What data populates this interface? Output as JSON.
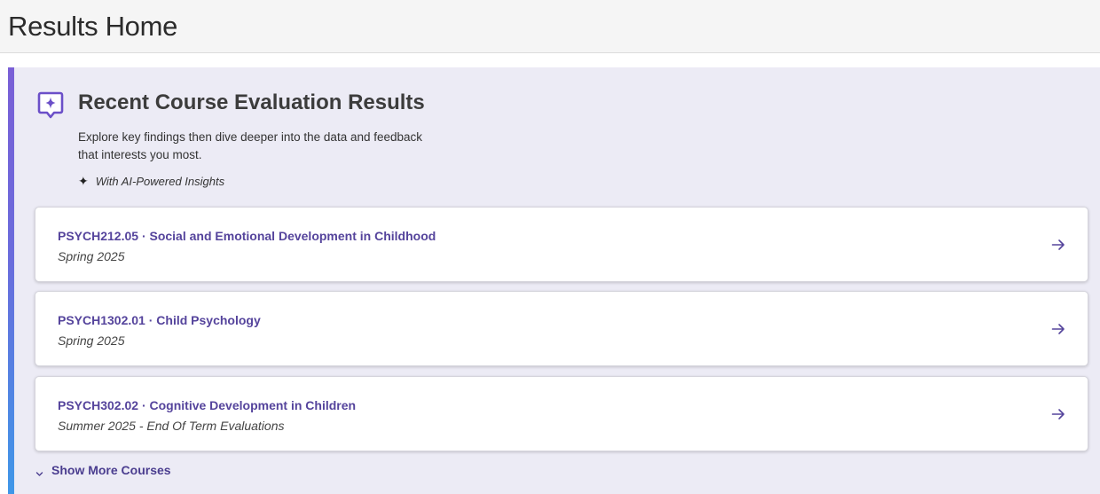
{
  "page": {
    "title": "Results Home"
  },
  "panel": {
    "heading": "Recent Course Evaluation Results",
    "description": "Explore key findings then dive deeper into the data and feedback that interests you most.",
    "ai_badge": "With AI-Powered Insights",
    "icon": "sparkle-chat-icon",
    "accent_colors": [
      "#7a5fd6",
      "#3f97e8"
    ]
  },
  "courses": [
    {
      "title": "PSYCH212.05 · Social and Emotional Development in Childhood",
      "term": "Spring 2025"
    },
    {
      "title": "PSYCH1302.01 · Child Psychology",
      "term": "Spring 2025"
    },
    {
      "title": "PSYCH302.02 · Cognitive Development in Children",
      "term": "Summer 2025 - End Of Term Evaluations"
    }
  ],
  "show_more": {
    "label": "Show More Courses",
    "icon": "chevron-down-icon"
  },
  "colors": {
    "link": "#55449c",
    "panel_bg": "#ecebf5"
  }
}
